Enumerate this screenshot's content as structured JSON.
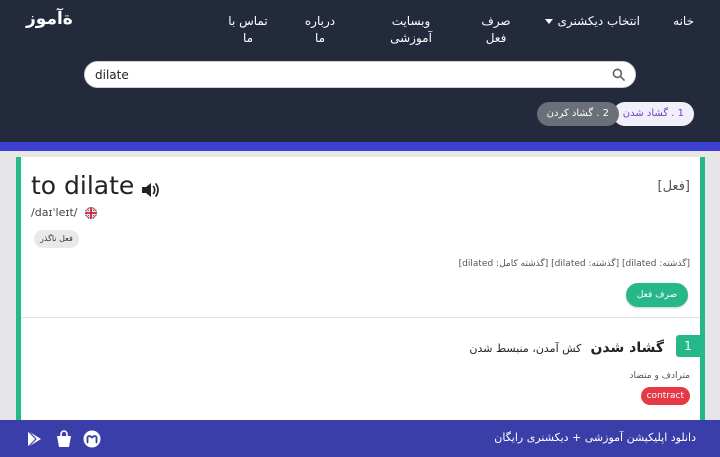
{
  "header": {
    "logo": "ﺓآموز",
    "nav": {
      "home": "خانه",
      "dictionary": "انتخاب دیکشنری",
      "conjugation": "صرف فعل",
      "site": "وبسایت آموزشی",
      "about": "درباره ما",
      "contact": "تماس با ما"
    },
    "search": {
      "value": "dilate",
      "icon": "search-icon"
    },
    "senses": [
      {
        "label": "1 . گشاد شدن"
      },
      {
        "label": "2 . گشاد کردن"
      }
    ]
  },
  "entry": {
    "headword": "to dilate",
    "part_of_speech": "[فعل]",
    "pronunciation": "/daɪˈleɪt/",
    "badge": "فعل ناگذر",
    "forms": "[گذشته: dilated] [گذشته: dilated] [گذشته کامل: dilated]",
    "conjugate_button": "صرف فعل",
    "sense": {
      "number": "1",
      "word": "گشاد شدن",
      "definition": "کش آمدن، منبسط شدن",
      "synonyms_label": "مترادف و متضاد",
      "antonym": "contract"
    }
  },
  "footer": {
    "text": "دانلود اپلیکیشن آموزشی + دیکشنری رایگان",
    "icons": [
      "google-play-icon",
      "shopping-bag-icon",
      "myket-icon"
    ]
  },
  "colors": {
    "header_bg": "#222a3c",
    "accent_green": "#26b889",
    "stripe_blue": "#3d3fd1",
    "footer_bg": "#3a3ea8",
    "tag_red": "#e63946"
  }
}
